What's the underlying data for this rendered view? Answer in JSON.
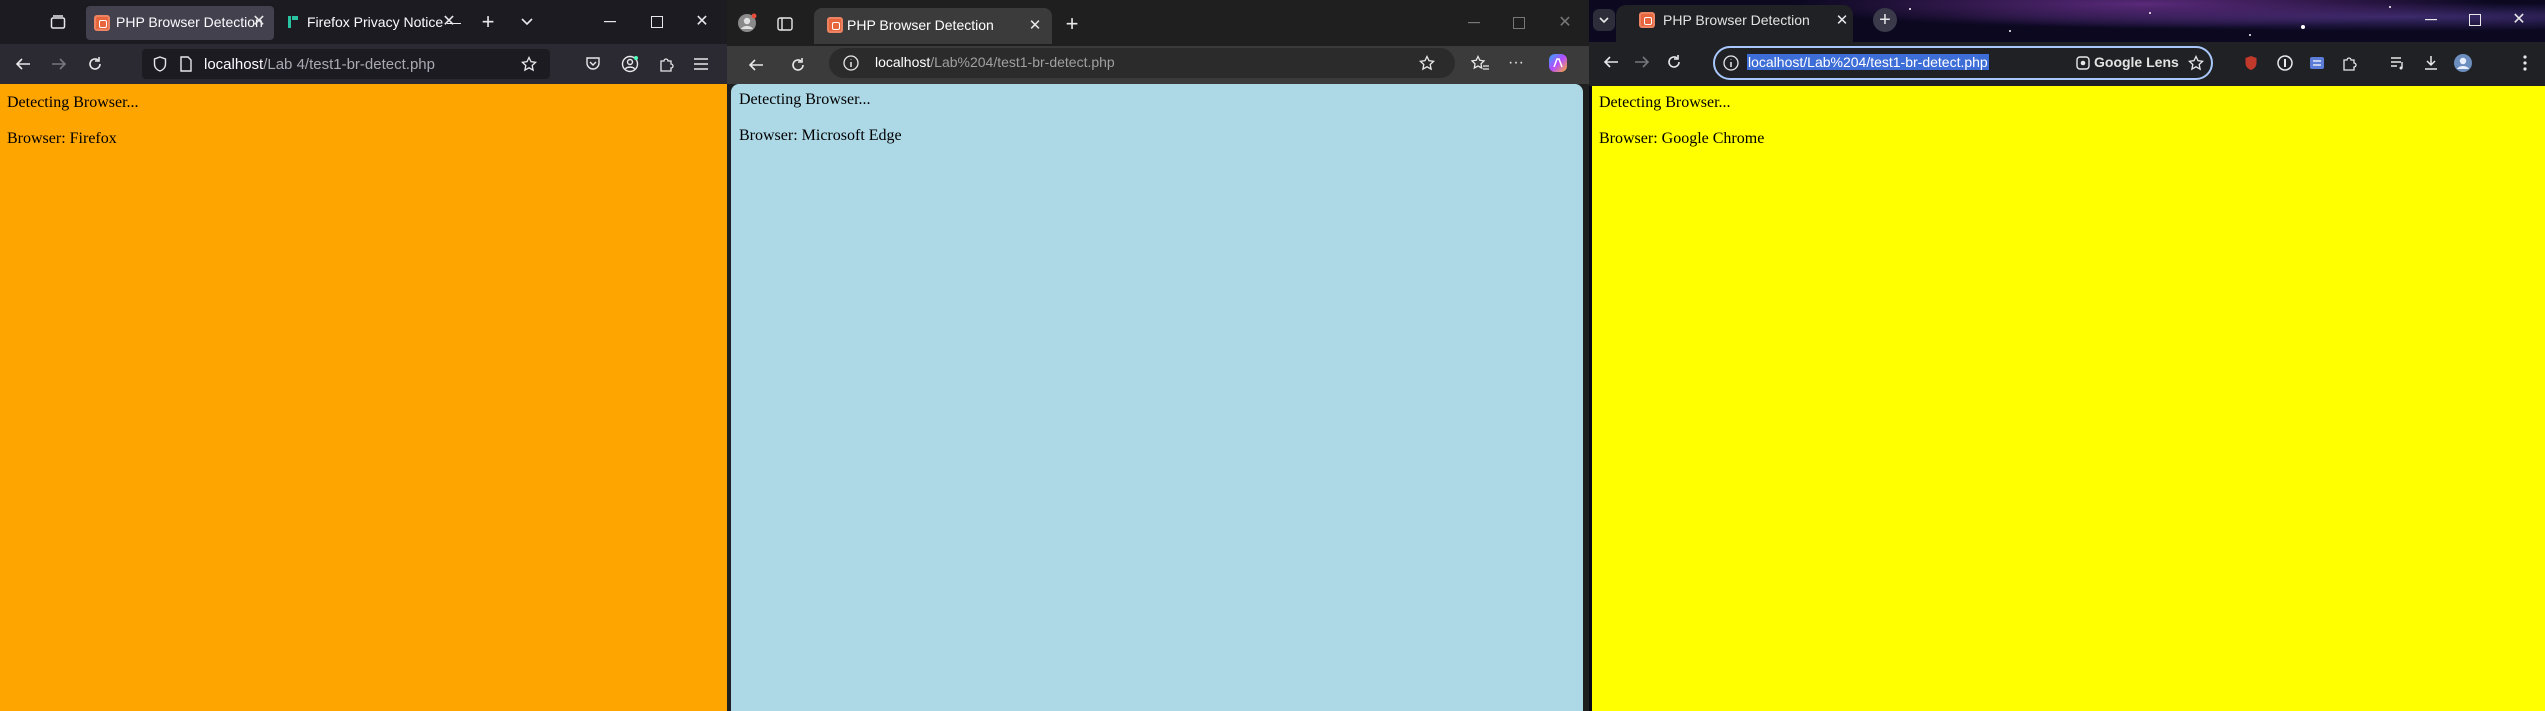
{
  "firefox": {
    "tabs": [
      {
        "title": "PHP Browser Detection",
        "active": true
      },
      {
        "title": "Firefox Privacy Notice —",
        "active": false
      }
    ],
    "url": {
      "host": "localhost",
      "path": "/Lab 4/test1-br-detect.php"
    },
    "page": {
      "line1": "Detecting Browser...",
      "line2": "Browser: Firefox",
      "background": "#ffa500"
    }
  },
  "edge": {
    "tabs": [
      {
        "title": "PHP Browser Detection",
        "active": true
      }
    ],
    "url": {
      "host": "localhost",
      "path": "/Lab%204/test1-br-detect.php"
    },
    "page": {
      "line1": "Detecting Browser...",
      "line2": "Browser: Microsoft Edge",
      "background": "#add8e6"
    }
  },
  "chrome": {
    "tabs": [
      {
        "title": "PHP Browser Detection",
        "active": true
      }
    ],
    "url": {
      "host": "localhost",
      "path": "/Lab%204/test1-br-detect.php"
    },
    "lens_label": "Google Lens",
    "page": {
      "line1": "Detecting Browser...",
      "line2": "Browser: Google Chrome",
      "background": "#ffff00"
    }
  }
}
